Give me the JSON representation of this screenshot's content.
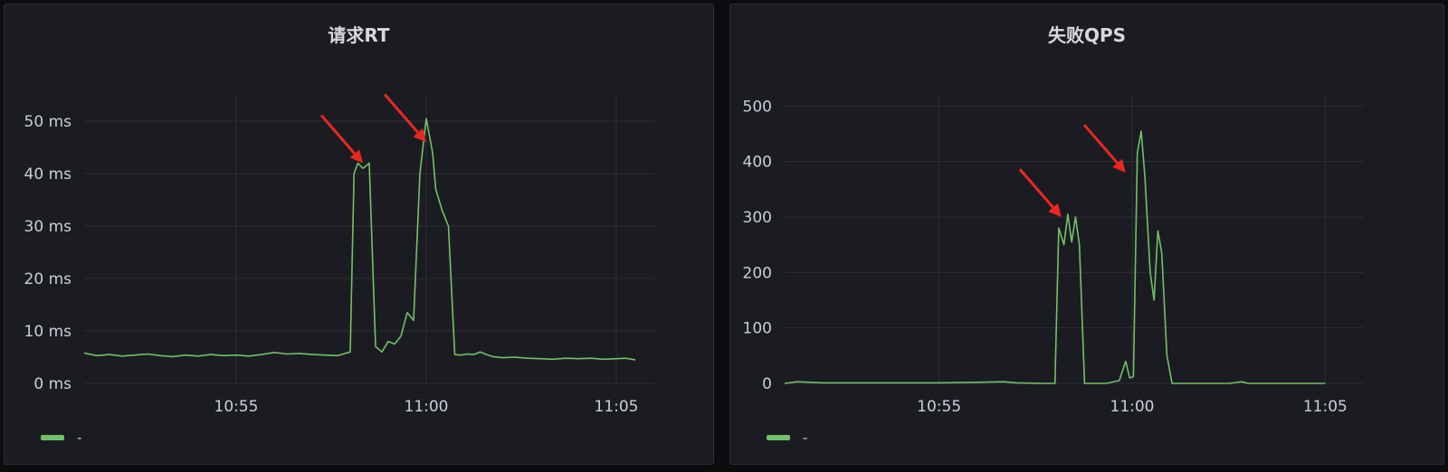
{
  "colors": {
    "series": "#73bf69",
    "arrow": "#e8281f",
    "panel_bg": "#1b1c21",
    "grid": "#2c2e34",
    "text": "#c7d0d9"
  },
  "chart_data": [
    {
      "type": "line",
      "title": "请求RT",
      "xlabel": "",
      "ylabel": "",
      "y_unit_suffix": " ms",
      "ylim": [
        0,
        55
      ],
      "yticks": [
        0,
        10,
        20,
        30,
        40,
        50
      ],
      "ytick_labels": [
        "0 ms",
        "10 ms",
        "20 ms",
        "30 ms",
        "40 ms",
        "50 ms"
      ],
      "xlim": [
        "10:51",
        "11:06"
      ],
      "xticks": [
        "10:55",
        "11:00",
        "11:05"
      ],
      "grid": true,
      "legend": {
        "placement": "bottom-left",
        "entries": [
          "-"
        ]
      },
      "annotations": [
        {
          "type": "arrow",
          "points_to": {
            "x": "10:58:20",
            "y": 42
          }
        },
        {
          "type": "arrow",
          "points_to": {
            "x": "11:00:00",
            "y": 46
          }
        }
      ],
      "series": [
        {
          "x": [
            "10:51:00",
            "10:51:20",
            "10:51:40",
            "10:52:00",
            "10:52:20",
            "10:52:40",
            "10:53:00",
            "10:53:20",
            "10:53:40",
            "10:54:00",
            "10:54:20",
            "10:54:40",
            "10:55:00",
            "10:55:20",
            "10:55:40",
            "10:56:00",
            "10:56:20",
            "10:56:40",
            "10:57:00",
            "10:57:20",
            "10:57:40",
            "10:58:00",
            "10:58:06",
            "10:58:12",
            "10:58:20",
            "10:58:30",
            "10:58:40",
            "10:58:50",
            "10:59:00",
            "10:59:10",
            "10:59:20",
            "10:59:30",
            "10:59:40",
            "10:59:50",
            "11:00:00",
            "11:00:10",
            "11:00:15",
            "11:00:25",
            "11:00:35",
            "11:00:45",
            "11:00:55",
            "11:01:05",
            "11:01:15",
            "11:01:25",
            "11:01:35",
            "11:01:45",
            "11:02:00",
            "11:02:20",
            "11:02:40",
            "11:03:00",
            "11:03:20",
            "11:03:40",
            "11:04:00",
            "11:04:20",
            "11:04:40",
            "11:05:00",
            "11:05:15",
            "11:05:30"
          ],
          "y": [
            5.8,
            5.3,
            5.5,
            5.2,
            5.4,
            5.6,
            5.3,
            5.1,
            5.4,
            5.2,
            5.5,
            5.3,
            5.4,
            5.2,
            5.5,
            5.9,
            5.6,
            5.7,
            5.5,
            5.4,
            5.3,
            6,
            40,
            42,
            41,
            42,
            7,
            6,
            8,
            7.5,
            9,
            13.5,
            12,
            40,
            50.5,
            44,
            37,
            33,
            30,
            5.5,
            5.4,
            5.6,
            5.5,
            6,
            5.5,
            5.1,
            4.9,
            5,
            4.8,
            4.7,
            4.6,
            4.8,
            4.7,
            4.8,
            4.6,
            4.7,
            4.8,
            4.5
          ]
        }
      ]
    },
    {
      "type": "line",
      "title": "失败QPS",
      "xlabel": "",
      "ylabel": "",
      "ylim": [
        0,
        520
      ],
      "yticks": [
        0,
        100,
        200,
        300,
        400,
        500
      ],
      "ytick_labels": [
        "0",
        "100",
        "200",
        "300",
        "400",
        "500"
      ],
      "xlim": [
        "10:51",
        "11:06"
      ],
      "xticks": [
        "10:55",
        "11:00",
        "11:05"
      ],
      "grid": true,
      "legend": {
        "placement": "bottom-left",
        "entries": [
          "-"
        ]
      },
      "annotations": [
        {
          "type": "arrow",
          "points_to": {
            "x": "10:58:10",
            "y": 300
          }
        },
        {
          "type": "arrow",
          "points_to": {
            "x": "10:59:50",
            "y": 380
          }
        }
      ],
      "series": [
        {
          "x": [
            "10:51:00",
            "10:51:20",
            "10:51:40",
            "10:52:00",
            "10:53:00",
            "10:54:00",
            "10:55:00",
            "10:56:00",
            "10:56:40",
            "10:57:00",
            "10:57:40",
            "10:58:00",
            "10:58:06",
            "10:58:14",
            "10:58:20",
            "10:58:26",
            "10:58:32",
            "10:58:38",
            "10:58:46",
            "10:58:50",
            "10:59:00",
            "10:59:20",
            "10:59:40",
            "10:59:50",
            "10:59:56",
            "11:00:02",
            "11:00:08",
            "11:00:14",
            "11:00:20",
            "11:00:28",
            "11:00:34",
            "11:00:40",
            "11:00:46",
            "11:00:54",
            "11:01:02",
            "11:01:10",
            "11:01:30",
            "11:02:00",
            "11:02:30",
            "11:02:50",
            "11:03:00",
            "11:03:30",
            "11:04:00",
            "11:04:30",
            "11:05:00"
          ],
          "y": [
            0,
            3,
            2,
            1,
            1,
            1,
            1,
            2,
            3,
            1,
            0,
            0,
            280,
            250,
            305,
            255,
            300,
            250,
            0,
            0,
            0,
            0,
            5,
            40,
            10,
            12,
            415,
            455,
            370,
            200,
            150,
            275,
            235,
            50,
            0,
            0,
            0,
            0,
            0,
            3,
            0,
            0,
            0,
            0,
            0
          ]
        }
      ]
    }
  ]
}
